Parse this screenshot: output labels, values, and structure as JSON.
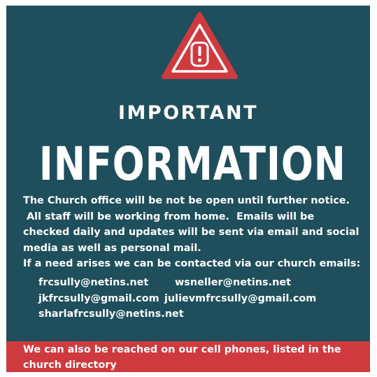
{
  "heading": {
    "line1": "IMPORTANT",
    "line2": "INFORMATION"
  },
  "body": {
    "lines": [
      "The Church office will be not be open until further notice.",
      " All staff will be working from home.  Emails will be",
      "checked daily and updates will be sent via email and social",
      "media as well as personal mail.",
      "If a need arises we can be contacted via our church emails:"
    ]
  },
  "emails": [
    "frcsully@netins.net",
    "wsneller@netins.net",
    "jkfrcsully@gmail.com",
    "julievmfrcsully@gmail.com",
    "sharlafrcsully@netins.net"
  ],
  "footer": {
    "text": "We can also be reached on our cell phones, listed in the church directory"
  },
  "colors": {
    "background": "#1f4f5c",
    "accent_red": "#cf3a3f",
    "text": "#ffffff"
  },
  "icons": {
    "warning": "warning-triangle-icon"
  }
}
